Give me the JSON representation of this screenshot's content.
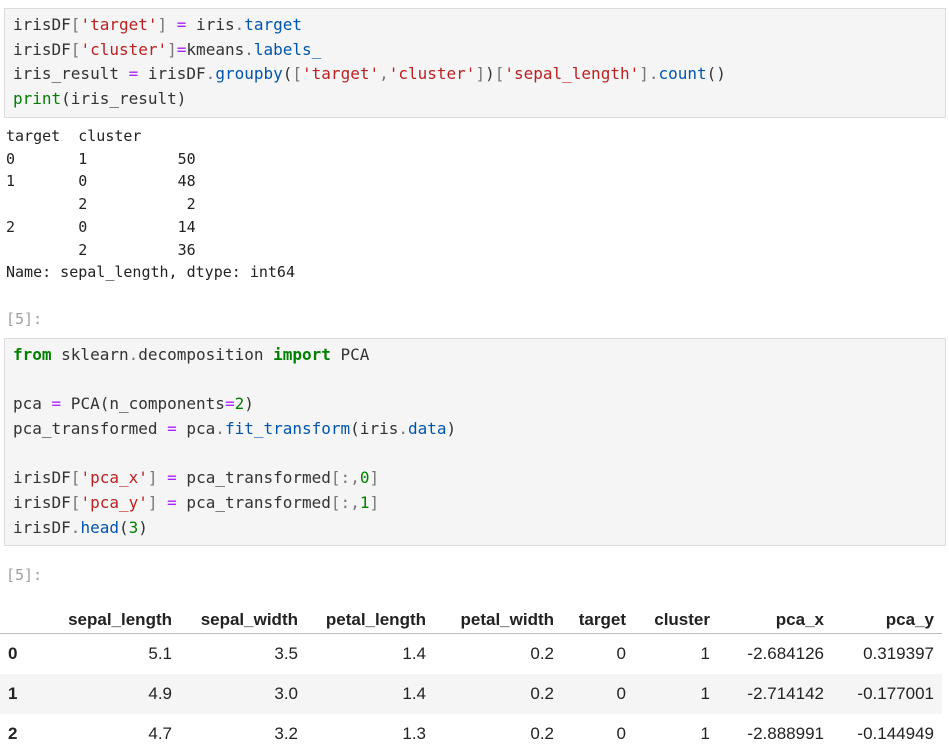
{
  "cell1": {
    "lines": [
      [
        [
          "plain",
          "irisDF"
        ],
        [
          "punc",
          "["
        ],
        [
          "str",
          "'target'"
        ],
        [
          "punc",
          "]"
        ],
        [
          "plain",
          " "
        ],
        [
          "op",
          "="
        ],
        [
          "plain",
          " iris"
        ],
        [
          "punc",
          "."
        ],
        [
          "attr",
          "target"
        ]
      ],
      [
        [
          "plain",
          "irisDF"
        ],
        [
          "punc",
          "["
        ],
        [
          "str",
          "'cluster'"
        ],
        [
          "punc",
          "]"
        ],
        [
          "op",
          "="
        ],
        [
          "plain",
          "kmeans"
        ],
        [
          "punc",
          "."
        ],
        [
          "attr",
          "labels_"
        ]
      ],
      [
        [
          "plain",
          "iris_result "
        ],
        [
          "op",
          "="
        ],
        [
          "plain",
          " irisDF"
        ],
        [
          "punc",
          "."
        ],
        [
          "attr",
          "groupby"
        ],
        [
          "plain",
          "("
        ],
        [
          "punc",
          "["
        ],
        [
          "str",
          "'target'"
        ],
        [
          "punc",
          ","
        ],
        [
          "str",
          "'cluster'"
        ],
        [
          "punc",
          "]"
        ],
        [
          "plain",
          ")"
        ],
        [
          "punc",
          "["
        ],
        [
          "str",
          "'sepal_length'"
        ],
        [
          "punc",
          "]"
        ],
        [
          "punc",
          "."
        ],
        [
          "attr",
          "count"
        ],
        [
          "plain",
          "()"
        ]
      ],
      [
        [
          "kw2",
          "print"
        ],
        [
          "plain",
          "(iris_result)"
        ]
      ]
    ]
  },
  "output1": {
    "lines": [
      "target  cluster",
      "0       1          50",
      "1       0          48",
      "        2           2",
      "2       0          14",
      "        2          36",
      "Name: sepal_length, dtype: int64"
    ]
  },
  "prompt2": "[5]:",
  "cell2": {
    "lines": [
      [
        [
          "kw",
          "from"
        ],
        [
          "plain",
          " sklearn"
        ],
        [
          "punc",
          "."
        ],
        [
          "plain",
          "decomposition "
        ],
        [
          "kw",
          "import"
        ],
        [
          "plain",
          " PCA"
        ]
      ],
      [],
      [
        [
          "plain",
          "pca "
        ],
        [
          "op",
          "="
        ],
        [
          "plain",
          " PCA(n_components"
        ],
        [
          "op",
          "="
        ],
        [
          "num",
          "2"
        ],
        [
          "plain",
          ")"
        ]
      ],
      [
        [
          "plain",
          "pca_transformed "
        ],
        [
          "op",
          "="
        ],
        [
          "plain",
          " pca"
        ],
        [
          "punc",
          "."
        ],
        [
          "attr",
          "fit_transform"
        ],
        [
          "plain",
          "(iris"
        ],
        [
          "punc",
          "."
        ],
        [
          "attr",
          "data"
        ],
        [
          "plain",
          ")"
        ]
      ],
      [],
      [
        [
          "plain",
          "irisDF"
        ],
        [
          "punc",
          "["
        ],
        [
          "str",
          "'pca_x'"
        ],
        [
          "punc",
          "]"
        ],
        [
          "plain",
          " "
        ],
        [
          "op",
          "="
        ],
        [
          "plain",
          " pca_transformed"
        ],
        [
          "punc",
          "[:"
        ],
        [
          "punc",
          ","
        ],
        [
          "num",
          "0"
        ],
        [
          "punc",
          "]"
        ]
      ],
      [
        [
          "plain",
          "irisDF"
        ],
        [
          "punc",
          "["
        ],
        [
          "str",
          "'pca_y'"
        ],
        [
          "punc",
          "]"
        ],
        [
          "plain",
          " "
        ],
        [
          "op",
          "="
        ],
        [
          "plain",
          " pca_transformed"
        ],
        [
          "punc",
          "[:"
        ],
        [
          "punc",
          ","
        ],
        [
          "num",
          "1"
        ],
        [
          "punc",
          "]"
        ]
      ],
      [
        [
          "plain",
          "irisDF"
        ],
        [
          "punc",
          "."
        ],
        [
          "attr",
          "head"
        ],
        [
          "plain",
          "("
        ],
        [
          "num",
          "3"
        ],
        [
          "plain",
          ")"
        ]
      ]
    ]
  },
  "prompt3": "[5]:",
  "table": {
    "columns": [
      "",
      "sepal_length",
      "sepal_width",
      "petal_length",
      "petal_width",
      "target",
      "cluster",
      "pca_x",
      "pca_y"
    ],
    "rows": [
      [
        "0",
        "5.1",
        "3.5",
        "1.4",
        "0.2",
        "0",
        "1",
        "-2.684126",
        "0.319397"
      ],
      [
        "1",
        "4.9",
        "3.0",
        "1.4",
        "0.2",
        "0",
        "1",
        "-2.714142",
        "-0.177001"
      ],
      [
        "2",
        "4.7",
        "3.2",
        "1.3",
        "0.2",
        "0",
        "1",
        "-2.888991",
        "-0.144949"
      ]
    ]
  },
  "colors": {
    "keyword": "#008000",
    "string": "#ba2121",
    "operator": "#aa22ff",
    "attribute": "#0055aa",
    "cell_bg": "#f5f5f5",
    "prompt": "#9e9e9e"
  }
}
